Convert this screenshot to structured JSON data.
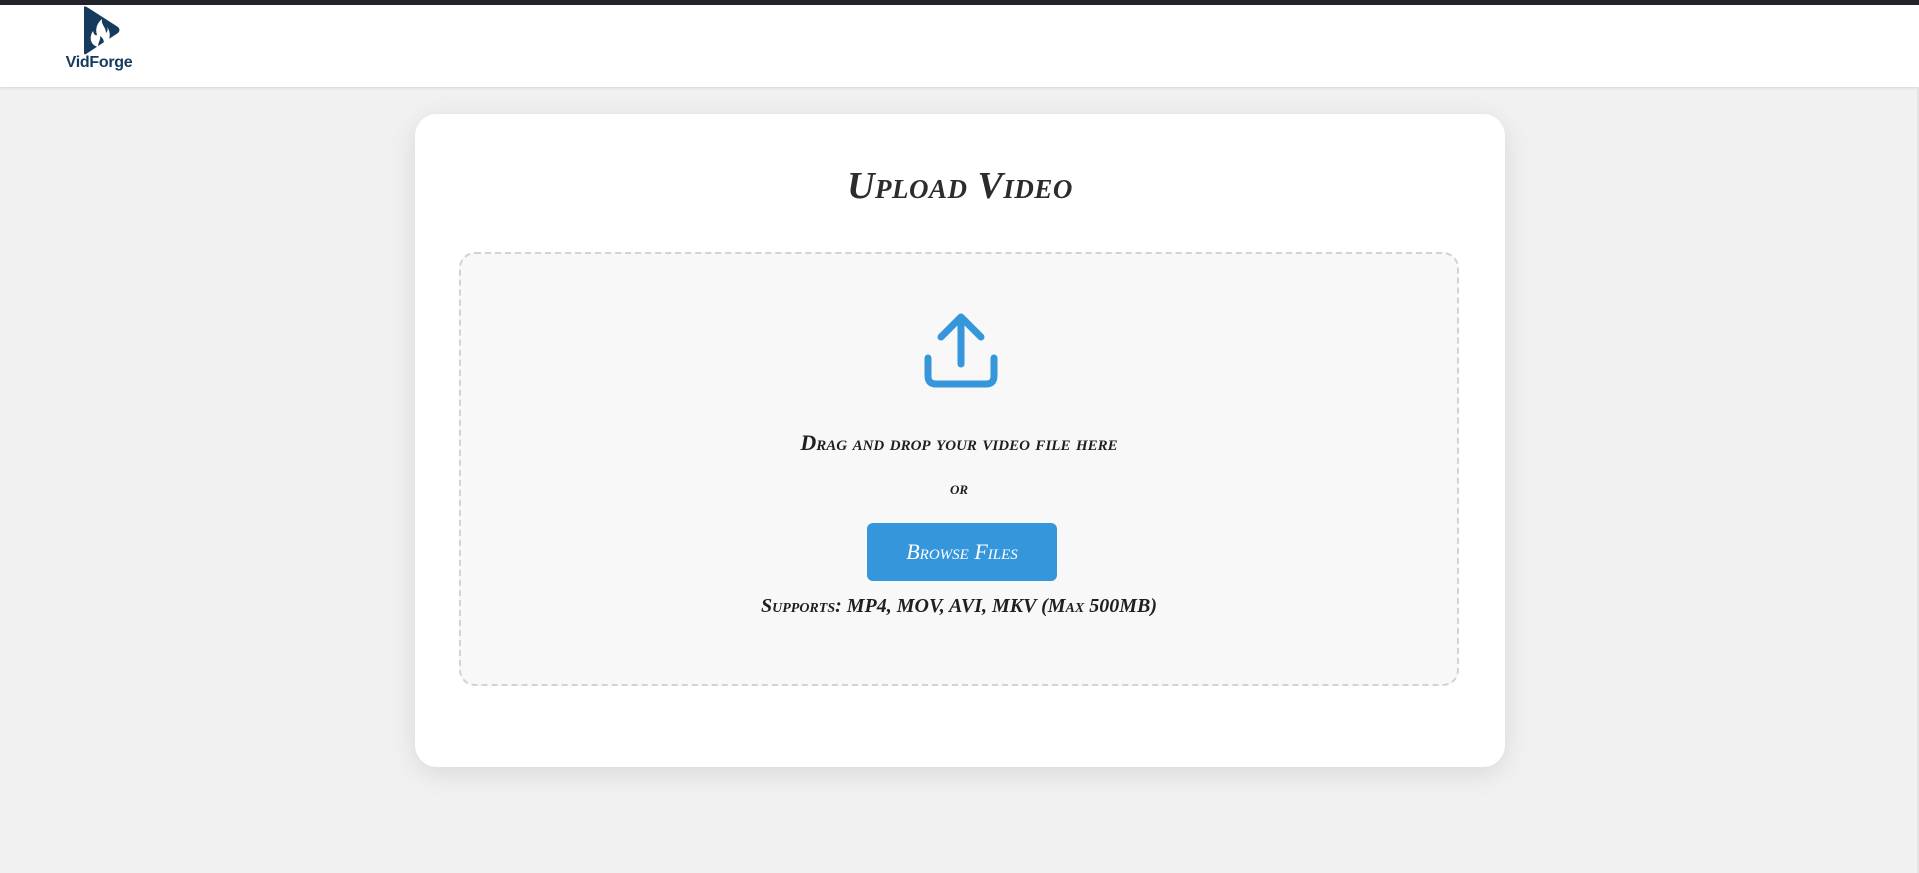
{
  "colors": {
    "accent": "#3596db",
    "brand": "#143a5e",
    "page_background": "#f1f1f1"
  },
  "header": {
    "logo": {
      "icon": "flame-play-logo-icon",
      "text": "VidForge"
    }
  },
  "upload": {
    "title": "Upload Video",
    "dropzone": {
      "icon": "upload-icon",
      "drag_text": "Drag and drop your video file here",
      "or_text": "or",
      "browse_label": "Browse Files",
      "supports_text": "Supports: MP4, MOV, AVI, MKV (Max 500MB)"
    }
  }
}
